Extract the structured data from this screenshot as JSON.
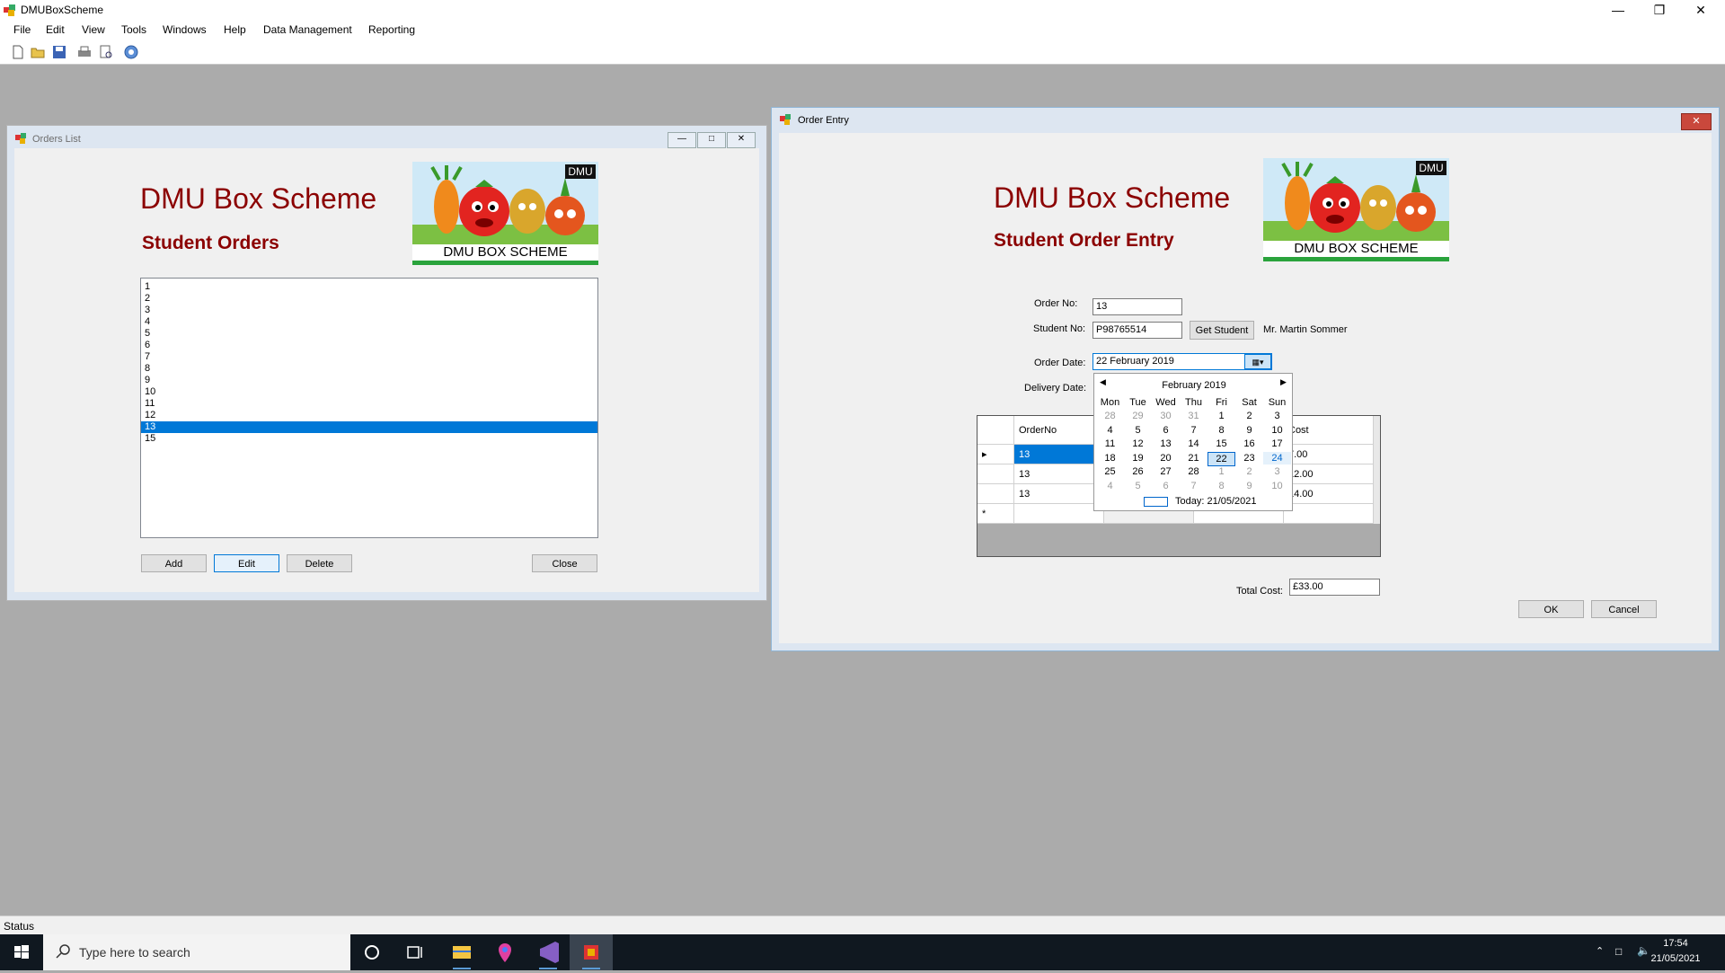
{
  "app": {
    "title": "DMUBoxScheme"
  },
  "menu": [
    "File",
    "Edit",
    "View",
    "Tools",
    "Windows",
    "Help",
    "Data Management",
    "Reporting"
  ],
  "status": "Status",
  "orders_list": {
    "title": "Orders List",
    "heading": "DMU Box Scheme",
    "subheading": "Student Orders",
    "logo_badge": "DMU",
    "logo_text": "DMU BOX SCHEME",
    "items": [
      "1",
      "2",
      "3",
      "4",
      "5",
      "6",
      "7",
      "8",
      "9",
      "10",
      "11",
      "12",
      "13",
      "15"
    ],
    "selected": "13",
    "buttons": {
      "add": "Add",
      "edit": "Edit",
      "delete": "Delete",
      "close": "Close"
    }
  },
  "order_entry": {
    "title": "Order Entry",
    "heading": "DMU Box Scheme",
    "subheading": "Student Order Entry",
    "logo_badge": "DMU",
    "logo_text": "DMU BOX SCHEME",
    "order_no_label": "Order No:",
    "order_no": "13",
    "student_no_label": "Student No:",
    "student_no": "P98765514",
    "get_student": "Get Student",
    "student_name": "Mr. Martin Sommer",
    "order_date_label": "Order Date:",
    "order_date": "22  February  2019",
    "delivery_date_label": "Delivery Date:",
    "grid": {
      "col_orderno": "OrderNo",
      "col_cost": "Cost",
      "rows": [
        {
          "orderno": "13",
          "cost": "7.00"
        },
        {
          "orderno": "13",
          "cost": "12.00"
        },
        {
          "orderno": "13",
          "cost": "14.00"
        }
      ]
    },
    "total_cost_label": "Total Cost:",
    "total_cost": "£33.00",
    "ok": "OK",
    "cancel": "Cancel"
  },
  "calendar": {
    "month": "February 2019",
    "days": [
      "Mon",
      "Tue",
      "Wed",
      "Thu",
      "Fri",
      "Sat",
      "Sun"
    ],
    "weeks": [
      [
        "28",
        "29",
        "30",
        "31",
        "1",
        "2",
        "3"
      ],
      [
        "4",
        "5",
        "6",
        "7",
        "8",
        "9",
        "10"
      ],
      [
        "11",
        "12",
        "13",
        "14",
        "15",
        "16",
        "17"
      ],
      [
        "18",
        "19",
        "20",
        "21",
        "22",
        "23",
        "24"
      ],
      [
        "25",
        "26",
        "27",
        "28",
        "1",
        "2",
        "3"
      ],
      [
        "4",
        "5",
        "6",
        "7",
        "8",
        "9",
        "10"
      ]
    ],
    "selected": "22",
    "today": "Today: 21/05/2021"
  },
  "taskbar": {
    "search_placeholder": "Type here to search",
    "time": "17:54",
    "date": "21/05/2021"
  }
}
